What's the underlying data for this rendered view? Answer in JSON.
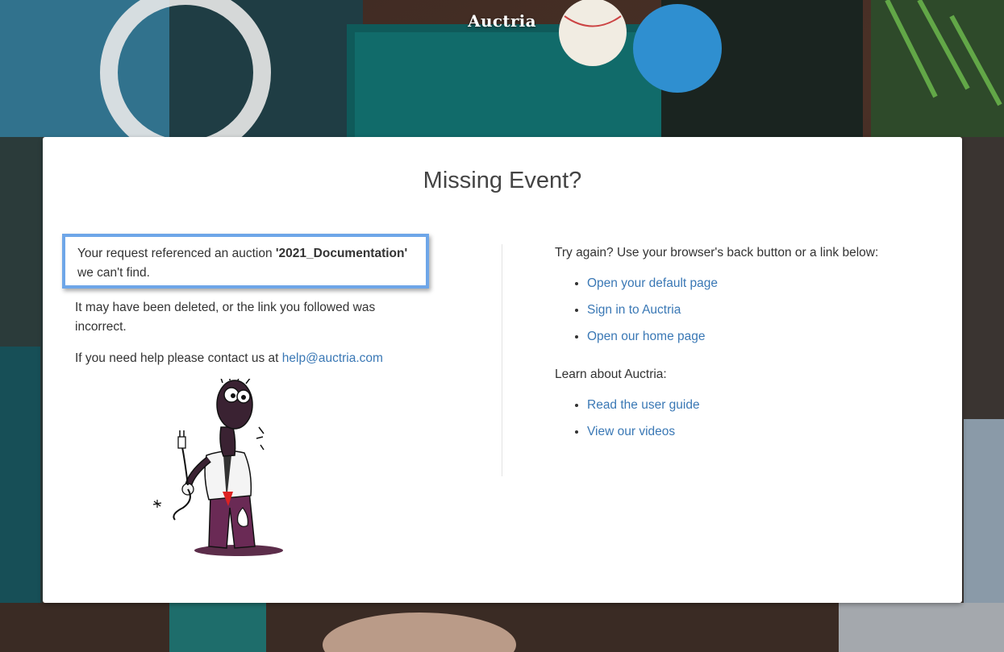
{
  "header": {
    "brand": "Auctria"
  },
  "card": {
    "title": "Missing Event?",
    "left": {
      "notice_prefix": "Your request referenced an auction ",
      "auction_name": "'2021_Documentation'",
      "notice_suffix": " we can't find.",
      "deleted_text": "It may have been deleted, or the link you followed was incorrect.",
      "help_prefix": "If you need help please contact us at ",
      "help_email": "help@auctria.com"
    },
    "right": {
      "try_again_text": "Try again? Use your browser's back button or a link below:",
      "links": [
        {
          "label": "Open your default page"
        },
        {
          "label": "Sign in to Auctria"
        },
        {
          "label": "Open our home page"
        }
      ],
      "learn_heading": "Learn about Auctria:",
      "learn_links": [
        {
          "label": "Read the user guide"
        },
        {
          "label": "View our videos"
        }
      ]
    }
  },
  "colors": {
    "link": "#3a78b5",
    "highlight_border": "#6ea6e8",
    "text": "#333333",
    "title": "#444444"
  },
  "icons": {
    "cartoon": "confused-man-holding-unplugged-cord"
  }
}
